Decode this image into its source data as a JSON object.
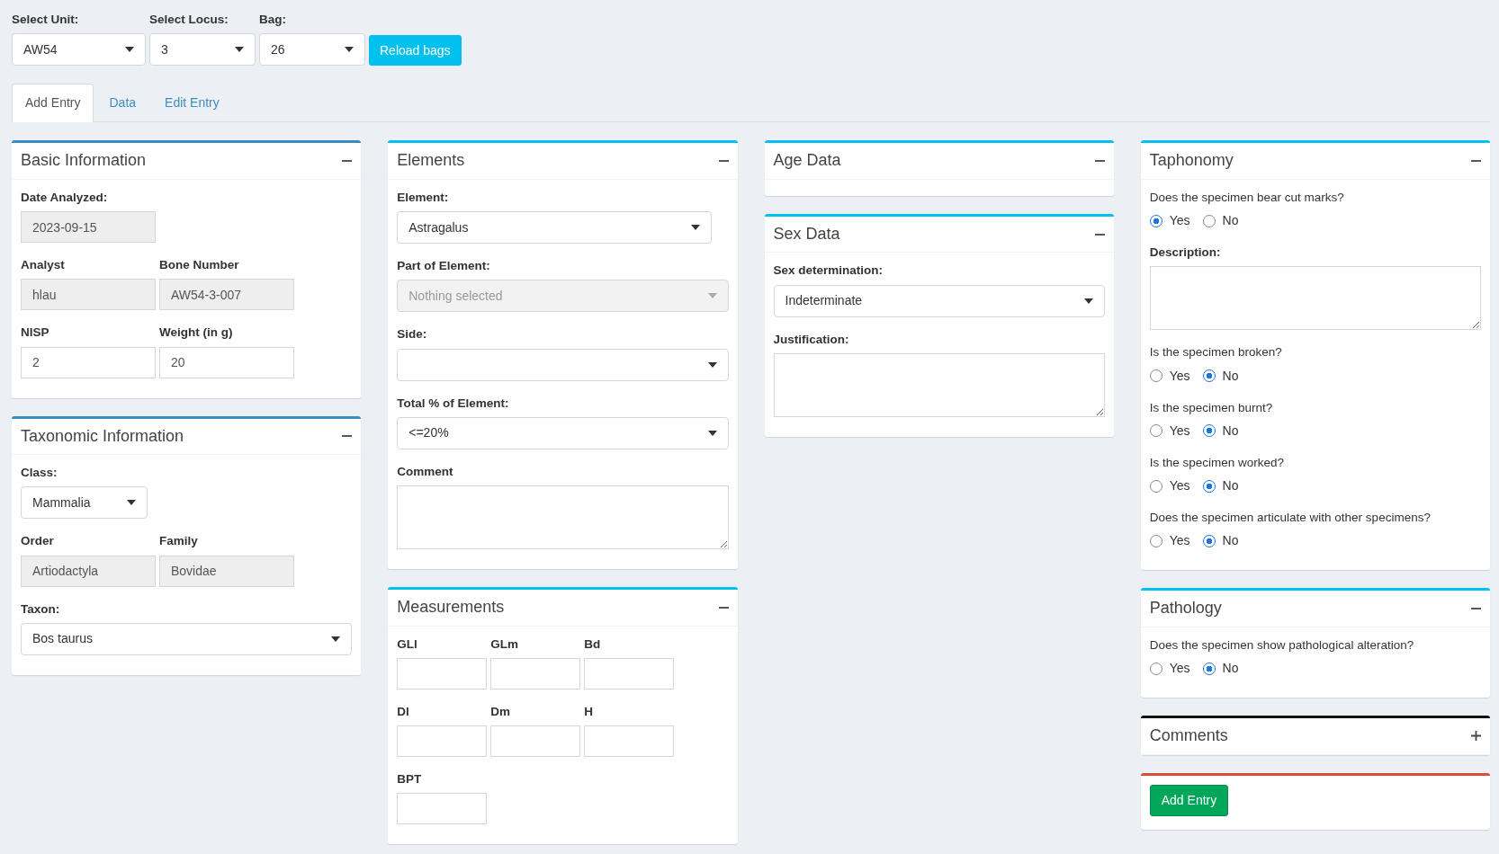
{
  "top_controls": [
    {
      "label": "Select Unit:",
      "value": "AW54"
    },
    {
      "label": "Select Locus:",
      "value": "3"
    },
    {
      "label": "Bag:",
      "value": "26"
    }
  ],
  "reload_button": "Reload bags",
  "tabs": [
    {
      "label": "Add Entry",
      "selected": true
    },
    {
      "label": "Data",
      "selected": false
    },
    {
      "label": "Edit Entry",
      "selected": false
    }
  ],
  "columns": [
    [
      {
        "title": "Basic Information",
        "color": "#3c8dbc",
        "collapsed": false,
        "rows": [
          [
            {
              "kind": "text",
              "label": "Date Analyzed:",
              "value": "2023-09-15",
              "readonly": true
            }
          ],
          [
            {
              "kind": "text",
              "label": "Analyst",
              "value": "hlau",
              "readonly": true
            },
            {
              "kind": "text",
              "label": "Bone Number",
              "value": "AW54-3-007",
              "readonly": true
            }
          ],
          [
            {
              "kind": "text",
              "label": "NISP",
              "value": "2",
              "readonly": false
            },
            {
              "kind": "text",
              "label": "Weight (in g)",
              "value": "20",
              "readonly": false
            }
          ]
        ]
      },
      {
        "title": "Taxonomic Information",
        "color": "#3c8dbc",
        "collapsed": false,
        "rows": [
          [
            {
              "kind": "picker-short",
              "label": "Class:",
              "value": "Mammalia"
            }
          ],
          [
            {
              "kind": "text",
              "label": "Order",
              "value": "Artiodactyla",
              "readonly": true
            },
            {
              "kind": "text",
              "label": "Family",
              "value": "Bovidae",
              "readonly": true
            }
          ],
          [
            {
              "kind": "select",
              "label": "Taxon:",
              "value": "Bos taurus"
            }
          ]
        ]
      }
    ],
    [
      {
        "title": "Elements",
        "color": "#00c0ef",
        "collapsed": false,
        "rows": [
          [
            {
              "kind": "picker",
              "label": "Element:",
              "value": "Astragalus"
            }
          ],
          [
            {
              "kind": "select",
              "label": "Part of Element:",
              "placeholder": "Nothing selected",
              "disabled": true
            }
          ],
          [
            {
              "kind": "select",
              "label": "Side:"
            }
          ],
          [
            {
              "kind": "select",
              "label": "Total % of Element:",
              "value": "<=20%"
            }
          ],
          [
            {
              "kind": "textarea",
              "label": "Comment"
            }
          ]
        ]
      },
      {
        "title": "Measurements",
        "color": "#00c0ef",
        "collapsed": false,
        "rows": [
          [
            {
              "kind": "measure",
              "label": "GLl"
            },
            {
              "kind": "measure",
              "label": "GLm"
            },
            {
              "kind": "measure",
              "label": "Bd"
            }
          ],
          [
            {
              "kind": "measure",
              "label": "Dl"
            },
            {
              "kind": "measure",
              "label": "Dm"
            },
            {
              "kind": "measure",
              "label": "H"
            }
          ],
          [
            {
              "kind": "measure",
              "label": "BPT"
            }
          ]
        ]
      }
    ],
    [
      {
        "title": "Age Data",
        "color": "#00c0ef",
        "collapsed": false
      },
      {
        "title": "Sex Data",
        "color": "#00c0ef",
        "collapsed": false,
        "rows": [
          [
            {
              "kind": "select",
              "label": "Sex determination:",
              "value": "Indeterminate"
            }
          ],
          [
            {
              "kind": "textarea",
              "label": "Justification:"
            }
          ]
        ]
      }
    ],
    [
      {
        "title": "Taphonomy",
        "color": "#00c0ef",
        "collapsed": false,
        "rows": [
          [
            {
              "kind": "radio",
              "label": "Does the specimen bear cut marks?",
              "options": [
                {
                  "label": "Yes",
                  "selected": true
                },
                {
                  "label": "No",
                  "selected": false
                }
              ]
            }
          ],
          [
            {
              "kind": "textarea",
              "label": "Description:"
            }
          ],
          [
            {
              "kind": "radio",
              "label": "Is the specimen broken?",
              "options": [
                {
                  "label": "Yes",
                  "selected": false
                },
                {
                  "label": "No",
                  "selected": true
                }
              ]
            }
          ],
          [
            {
              "kind": "radio",
              "label": "Is the specimen burnt?",
              "options": [
                {
                  "label": "Yes",
                  "selected": false
                },
                {
                  "label": "No",
                  "selected": true
                }
              ]
            }
          ],
          [
            {
              "kind": "radio",
              "label": "Is the specimen worked?",
              "options": [
                {
                  "label": "Yes",
                  "selected": false
                },
                {
                  "label": "No",
                  "selected": true
                }
              ]
            }
          ],
          [
            {
              "kind": "radio",
              "label": "Does the specimen articulate with other specimens?",
              "options": [
                {
                  "label": "Yes",
                  "selected": false
                },
                {
                  "label": "No",
                  "selected": true
                }
              ]
            }
          ]
        ]
      },
      {
        "title": "Pathology",
        "color": "#00c0ef",
        "collapsed": false,
        "rows": [
          [
            {
              "kind": "radio",
              "label": "Does the specimen show pathological alteration?",
              "options": [
                {
                  "label": "Yes",
                  "selected": false
                },
                {
                  "label": "No",
                  "selected": true
                }
              ]
            }
          ]
        ]
      },
      {
        "title": "Comments",
        "color": "#111111",
        "collapsed": true
      },
      {
        "color": "#dd4b39",
        "button": "Add Entry"
      }
    ]
  ]
}
